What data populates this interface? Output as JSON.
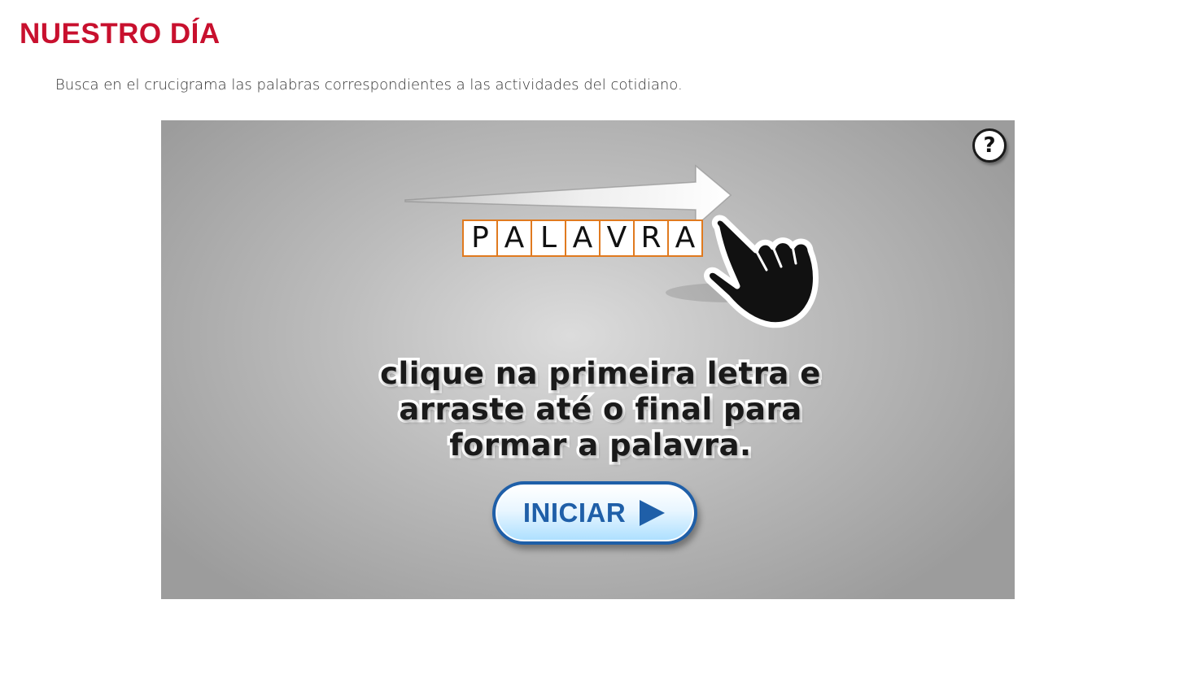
{
  "page": {
    "title": "NUESTRO DÍA",
    "instruction": "Busca en el crucigrama las palabras correspondientes a las actividades del cotidiano."
  },
  "game": {
    "help_label": "?",
    "example_letters": [
      "P",
      "A",
      "L",
      "A",
      "V",
      "R",
      "A"
    ],
    "tutorial_lines": [
      "clique na primeira letra e",
      "arraste até o final para",
      "formar a palavra."
    ],
    "start_label": "INICIAR",
    "icons": [
      "arrow-right-icon",
      "pointing-hand-icon",
      "play-icon"
    ],
    "colors": {
      "title": "#c8102e",
      "letter_border": "#e07a1f",
      "button_blue": "#1f5fa8"
    }
  }
}
